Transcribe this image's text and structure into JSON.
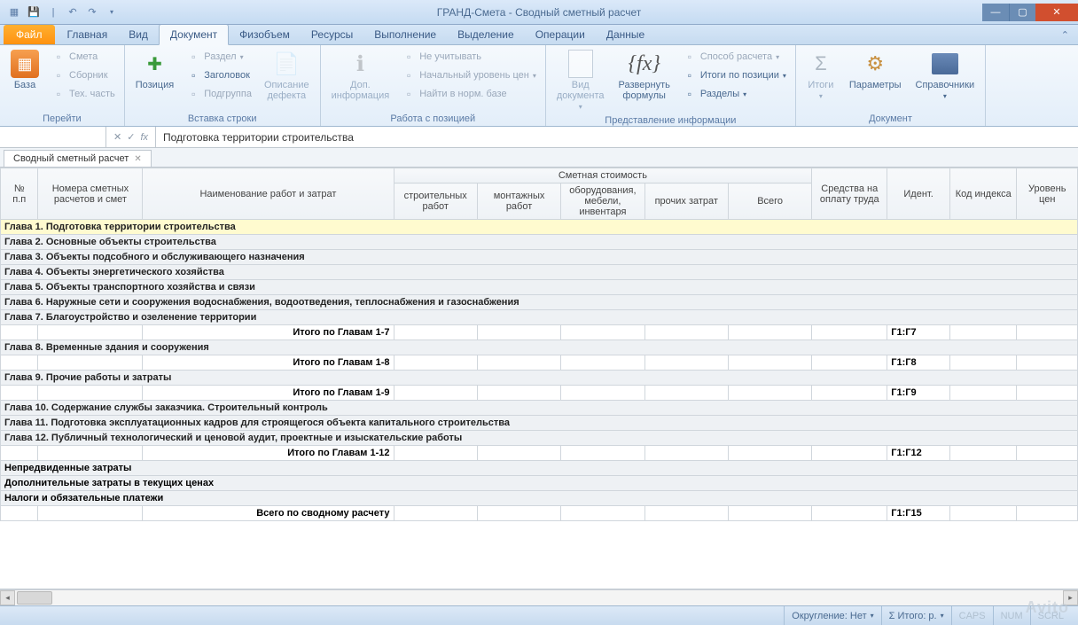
{
  "window": {
    "title": "ГРАНД-Смета - Сводный сметный расчет"
  },
  "tabs": {
    "file": "Файл",
    "items": [
      "Главная",
      "Вид",
      "Документ",
      "Физобъем",
      "Ресурсы",
      "Выполнение",
      "Выделение",
      "Операции",
      "Данные"
    ],
    "active": "Документ"
  },
  "ribbon": {
    "groups": [
      {
        "label": "Перейти",
        "big": {
          "name": "base-button",
          "label": "База"
        },
        "small": [
          {
            "name": "smeta-btn",
            "label": "Смета",
            "enabled": false
          },
          {
            "name": "sbornik-btn",
            "label": "Сборник",
            "enabled": false
          },
          {
            "name": "techpart-btn",
            "label": "Тех. часть",
            "enabled": false
          }
        ]
      },
      {
        "label": "Вставка строки",
        "big": {
          "name": "position-button",
          "label": "Позиция"
        },
        "small": [
          {
            "name": "section-btn",
            "label": "Раздел",
            "enabled": false,
            "dd": true
          },
          {
            "name": "header-btn",
            "label": "Заголовок",
            "enabled": true
          },
          {
            "name": "subgroup-btn",
            "label": "Подгруппа",
            "enabled": false
          },
          {
            "name": "defect-desc-btn",
            "label": "Описание\nдефекта",
            "enabled": false
          }
        ]
      },
      {
        "label": "Работа с позицией",
        "big1": {
          "name": "addinfo-button",
          "label": "Доп.\nинформация",
          "enabled": false
        },
        "small": [
          {
            "name": "exclude-btn",
            "label": "Не учитывать",
            "enabled": false
          },
          {
            "name": "initprice-btn",
            "label": "Начальный уровень цен",
            "enabled": false,
            "dd": true
          },
          {
            "name": "find-norm-btn",
            "label": "Найти в норм. базе",
            "enabled": false
          }
        ]
      },
      {
        "label": "Представление информации",
        "big1": {
          "name": "doc-view-button",
          "label": "Вид\nдокумента",
          "enabled": false,
          "dd": true
        },
        "big2": {
          "name": "expand-formulas-button",
          "label": "Развернуть\nформулы"
        },
        "small": [
          {
            "name": "calc-method-btn",
            "label": "Способ расчета",
            "enabled": false,
            "dd": true
          },
          {
            "name": "pos-totals-btn",
            "label": "Итоги по позиции",
            "enabled": true,
            "dd": true
          },
          {
            "name": "sections-btn",
            "label": "Разделы",
            "enabled": true,
            "dd": true
          }
        ]
      },
      {
        "label": "Документ",
        "bigs": [
          {
            "name": "totals-button",
            "label": "Итоги",
            "enabled": false,
            "dd": true
          },
          {
            "name": "params-button",
            "label": "Параметры"
          },
          {
            "name": "refs-button",
            "label": "Справочники",
            "dd": true
          }
        ]
      }
    ]
  },
  "formula": {
    "value": "Подготовка территории строительства",
    "fx": "fx"
  },
  "sheet_tab": "Сводный сметный расчет",
  "headers": {
    "row1": {
      "pp": "№\nп.п",
      "num": "Номера сметных расчетов и смет",
      "name": "Наименование работ и затрат",
      "cost": "Сметная стоимость",
      "labor": "Средства на оплату труда",
      "ident": "Идент.",
      "index": "Код индекса",
      "level": "Уровень цен"
    },
    "row2": {
      "c1": "строительных работ",
      "c2": "монтажных работ",
      "c3": "оборудования, мебели, инвентаря",
      "c4": "прочих затрат",
      "c5": "Всего"
    }
  },
  "rows": [
    {
      "type": "chapter",
      "selected": true,
      "text": "Глава 1. Подготовка территории строительства"
    },
    {
      "type": "chapter",
      "text": "Глава 2. Основные объекты строительства"
    },
    {
      "type": "chapter",
      "text": "Глава 3. Объекты подсобного и обслуживающего назначения"
    },
    {
      "type": "chapter",
      "text": "Глава 4. Объекты энергетического хозяйства"
    },
    {
      "type": "chapter",
      "text": "Глава 5. Объекты транспортного хозяйства и связи"
    },
    {
      "type": "chapter",
      "text": "Глава 6. Наружные сети и сооружения водоснабжения, водоотведения, теплоснабжения и газоснабжения"
    },
    {
      "type": "chapter",
      "text": "Глава 7. Благоустройство и озеленение территории"
    },
    {
      "type": "total",
      "label": "Итого по Главам 1-7",
      "ident": "Г1:Г7"
    },
    {
      "type": "chapter",
      "text": "Глава 8. Временные здания и сооружения"
    },
    {
      "type": "total",
      "label": "Итого по Главам 1-8",
      "ident": "Г1:Г8"
    },
    {
      "type": "chapter",
      "text": "Глава 9. Прочие работы и затраты"
    },
    {
      "type": "total",
      "label": "Итого по Главам 1-9",
      "ident": "Г1:Г9"
    },
    {
      "type": "chapter",
      "text": "Глава 10. Содержание службы заказчика. Строительный контроль"
    },
    {
      "type": "chapter",
      "text": "Глава 11. Подготовка эксплуатационных кадров для строящегося объекта капитального строительства"
    },
    {
      "type": "chapter",
      "text": "Глава 12. Публичный технологический и ценовой аудит, проектные и изыскательские работы"
    },
    {
      "type": "total",
      "label": "Итого по Главам 1-12",
      "ident": "Г1:Г12"
    },
    {
      "type": "plain",
      "text": "Непредвиденные затраты"
    },
    {
      "type": "plain",
      "text": "Дополнительные затраты в текущих ценах"
    },
    {
      "type": "plain",
      "text": "Налоги и обязательные платежи"
    },
    {
      "type": "grand",
      "label": "Всего по сводному расчету",
      "ident": "Г1:Г15"
    }
  ],
  "status": {
    "round": "Округление: Нет",
    "sigma": "Σ Итого: р.",
    "caps": "CAPS",
    "num": "NUM",
    "scrl": "SCRL"
  },
  "watermark": "Avito"
}
